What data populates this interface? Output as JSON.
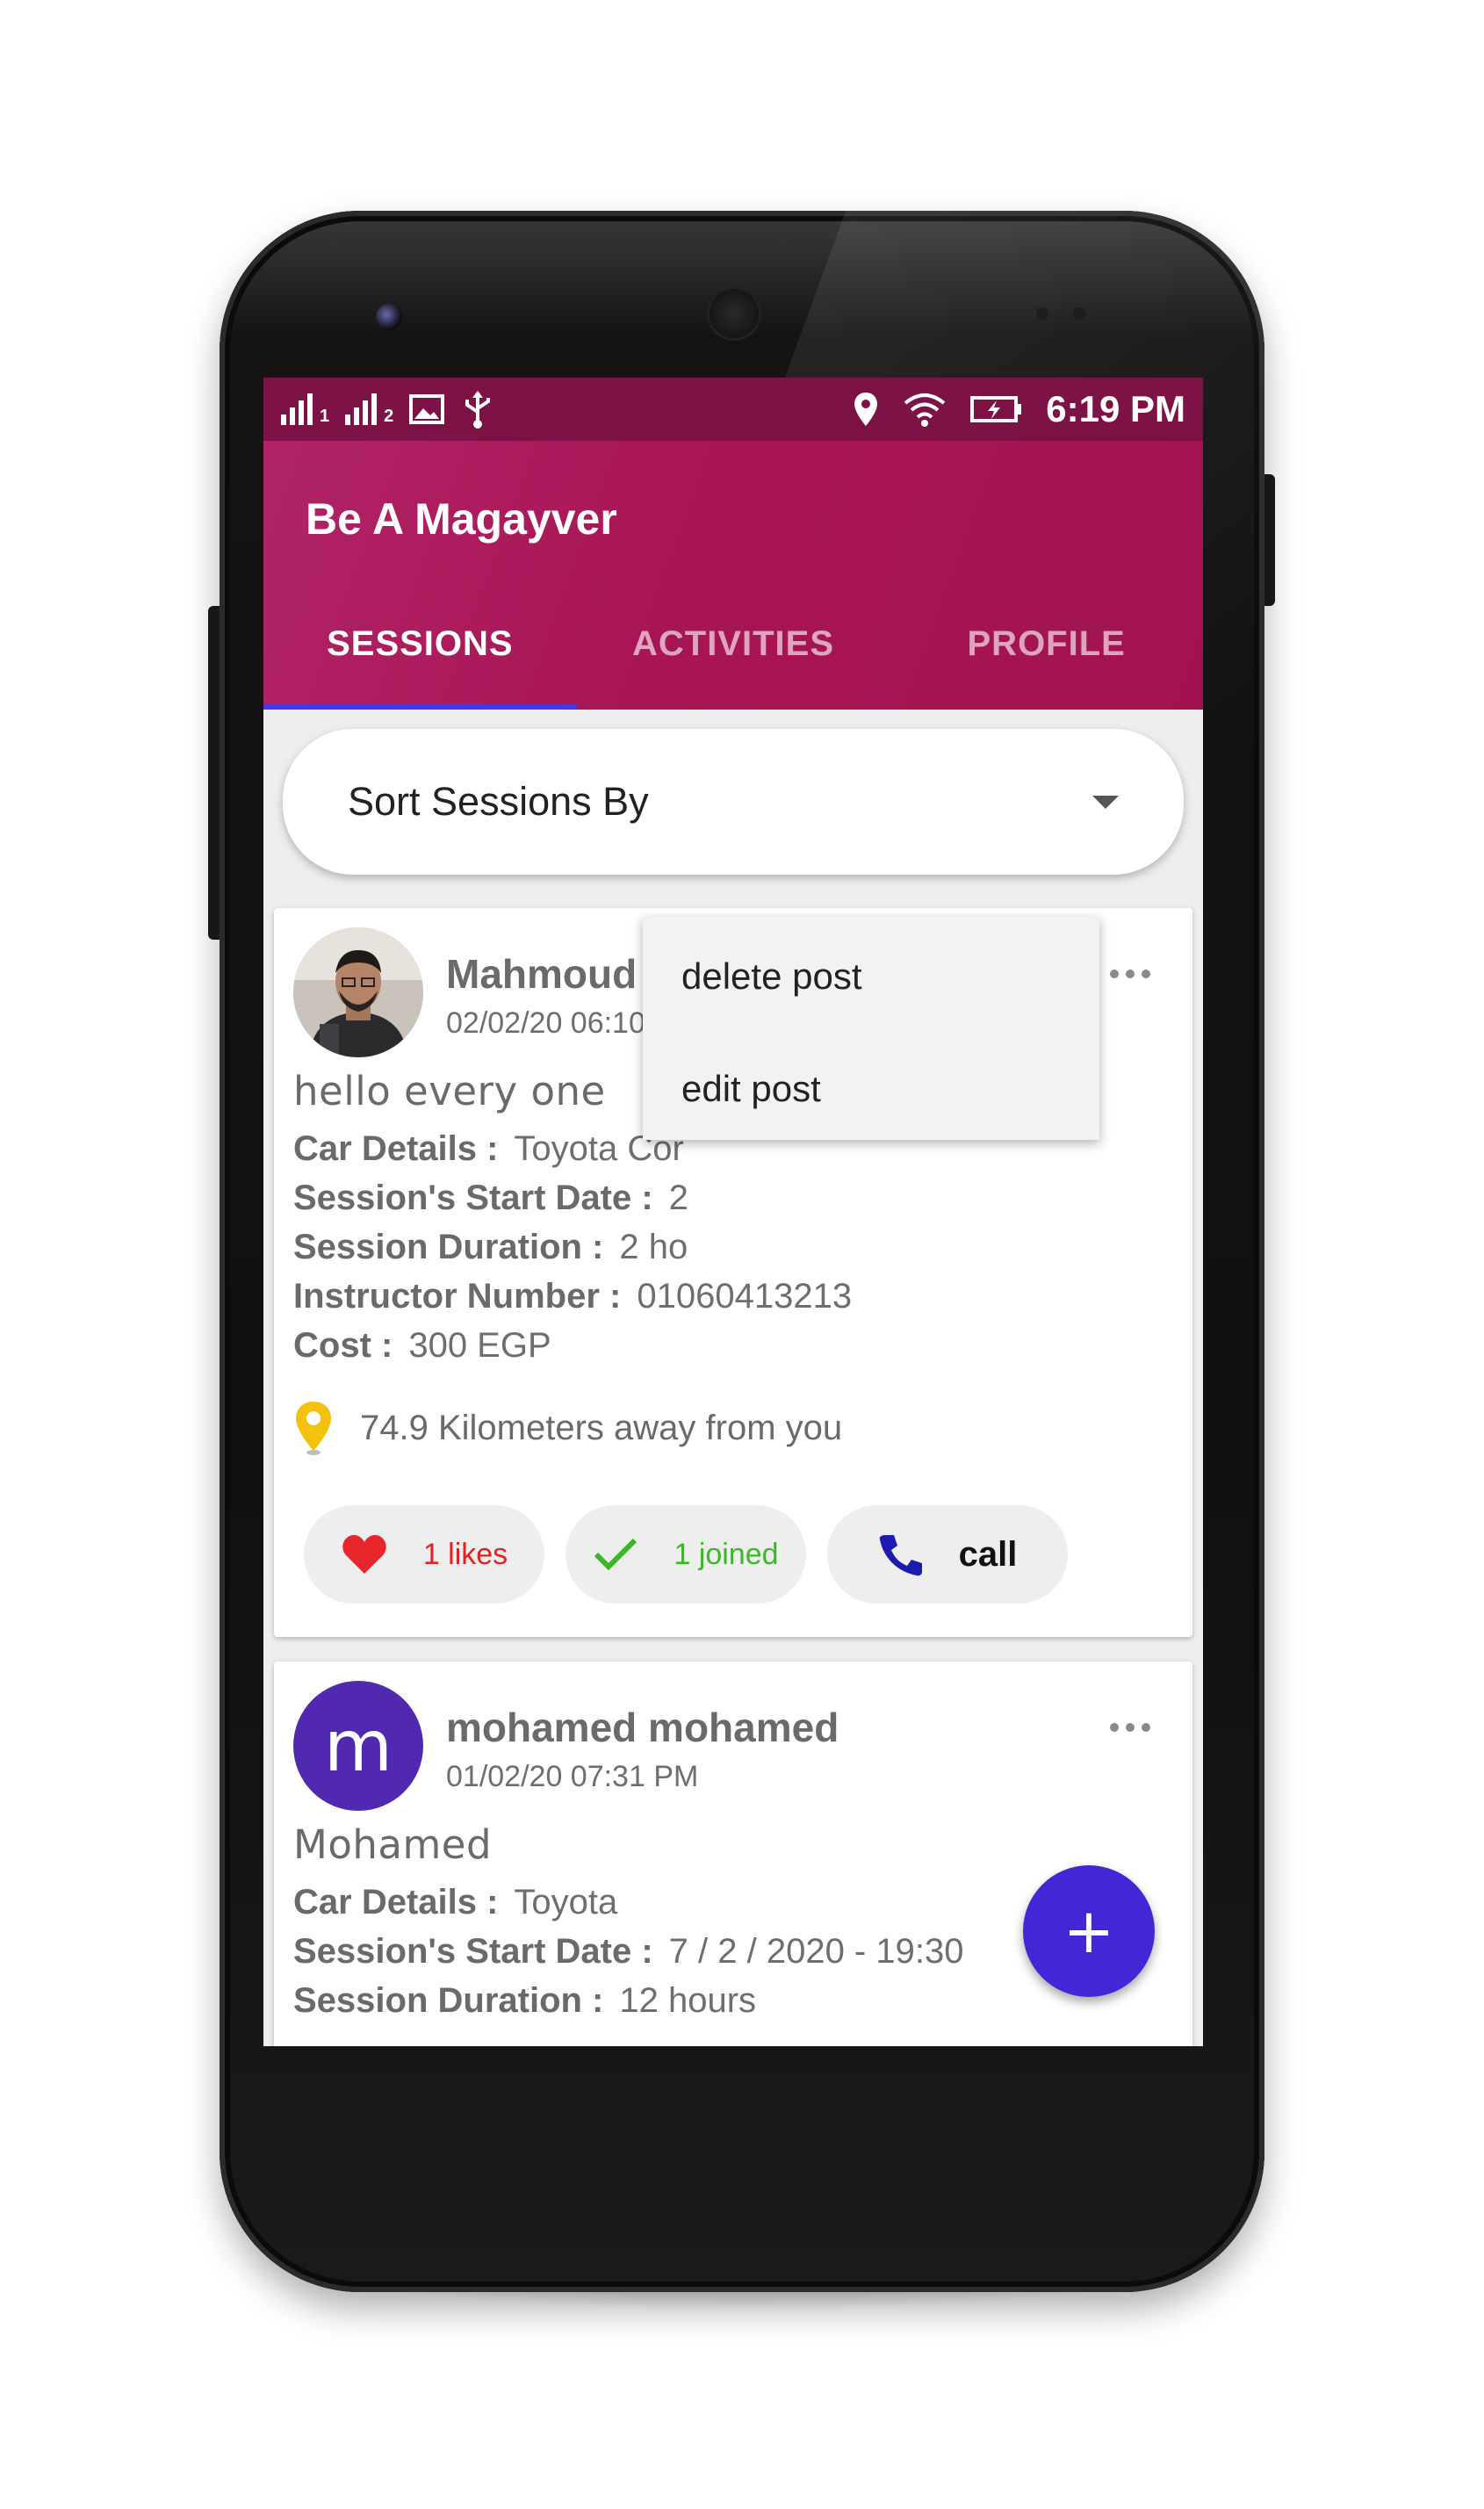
{
  "status_bar": {
    "sim1": "1",
    "sim2": "2",
    "time": "6:19 PM"
  },
  "app": {
    "title": "Be A Magayver",
    "tabs": [
      {
        "label": "SESSIONS",
        "active": true
      },
      {
        "label": "ACTIVITIES",
        "active": false
      },
      {
        "label": "PROFILE",
        "active": false
      }
    ],
    "accent_color": "#a81556",
    "tab_indicator_color": "#4a35e0"
  },
  "sort": {
    "label": "Sort Sessions By"
  },
  "posts": [
    {
      "author": "Mahmoud Osama",
      "date": "02/02/20 06:10 PM",
      "text": "hello every one",
      "car_label": "Car Details :",
      "car_value": "Toyota Cor",
      "start_label": "Session's Start Date :",
      "start_value": "2",
      "duration_label": "Session Duration :",
      "duration_value": "2 ho",
      "instructor_label": "Instructor Number :",
      "instructor_value": "01060413213",
      "cost_label": "Cost :",
      "cost_value": "300 EGP",
      "distance": "74.9 Kilometers away from you",
      "likes": "1 likes",
      "joined": "1 joined",
      "call": "call"
    },
    {
      "author": "mohamed mohamed",
      "avatar_letter": "m",
      "date": "01/02/20 07:31 PM",
      "text": "Mohamed",
      "car_label": "Car Details :",
      "car_value": "Toyota",
      "start_label": "Session's Start Date :",
      "start_value": "7 / 2 / 2020 - 19:30",
      "duration_label": "Session Duration :",
      "duration_value": "12 hours"
    }
  ],
  "menu": {
    "delete": "delete post",
    "edit": "edit post"
  },
  "fab": {
    "symbol": "+",
    "color": "#4426d6"
  }
}
